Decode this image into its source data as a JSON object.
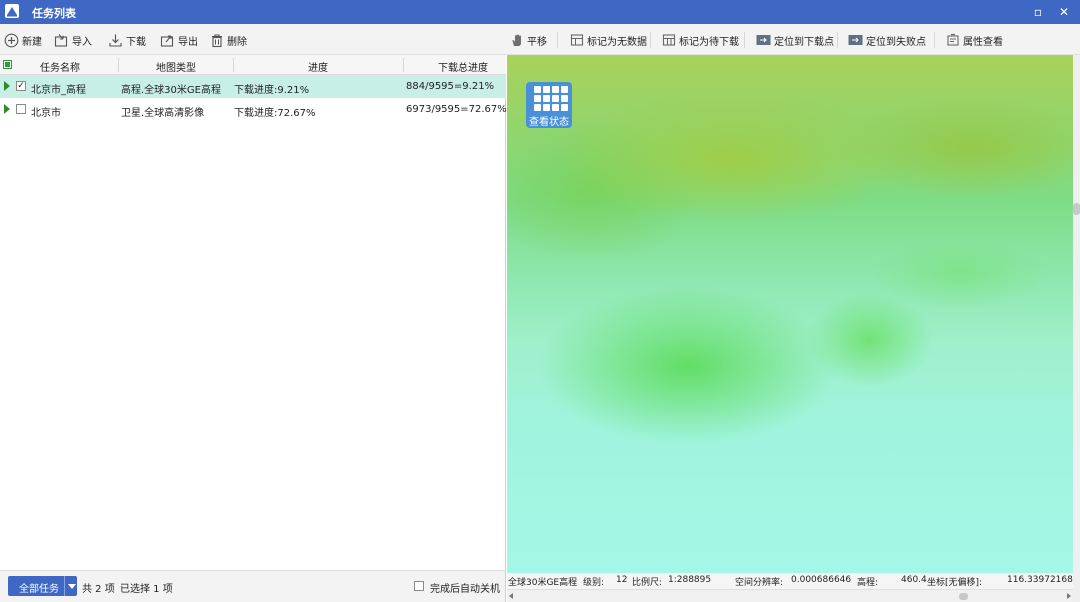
{
  "window": {
    "title": "任务列表",
    "minimize": "▫",
    "close": "✕"
  },
  "toolbar": {
    "new": "新建",
    "import": "导入",
    "download": "下载",
    "export": "导出",
    "delete": "删除",
    "pan": "平移",
    "mark_no_data": "标记为无数据",
    "mark_pending": "标记为待下载",
    "locate_download": "定位到下载点",
    "locate_failed": "定位到失败点",
    "properties": "属性查看"
  },
  "table": {
    "columns": [
      "任务名称",
      "地图类型",
      "进度",
      "下载总进度"
    ],
    "rows": [
      {
        "name": "北京市_高程",
        "map_type": "高程.全球30米GE高程",
        "progress": "下载进度:9.21%",
        "total": "884/9595=9.21%",
        "checked": true,
        "selected": true,
        "check_mark": "✓"
      },
      {
        "name": "北京市",
        "map_type": "卫星.全球高清影像",
        "progress": "下载进度:72.67%",
        "total": "6973/9595=72.67%",
        "checked": false,
        "selected": false,
        "check_mark": ""
      }
    ]
  },
  "footer": {
    "all_tasks": "全部任务",
    "total": "共 2 项",
    "selected": "已选择 1 项",
    "auto_shutdown": "完成后自动关机"
  },
  "map": {
    "status_button": "查看状态",
    "status": {
      "layer": "全球30米GE高程",
      "level_label": "级别:",
      "level": "12",
      "scale_label": "比例尺:",
      "scale": "1:288895",
      "resolution_label": "空间分辨率:",
      "resolution": "0.000686646",
      "elevation_label": "高程:",
      "elevation": "460.4",
      "coord_label": "坐标[无偏移]:",
      "coord": "116.33972168,"
    }
  },
  "colors": {
    "title_bar": "#3f67c4",
    "selected_row": "#c7efe6",
    "status_button": "#4a90d9"
  }
}
